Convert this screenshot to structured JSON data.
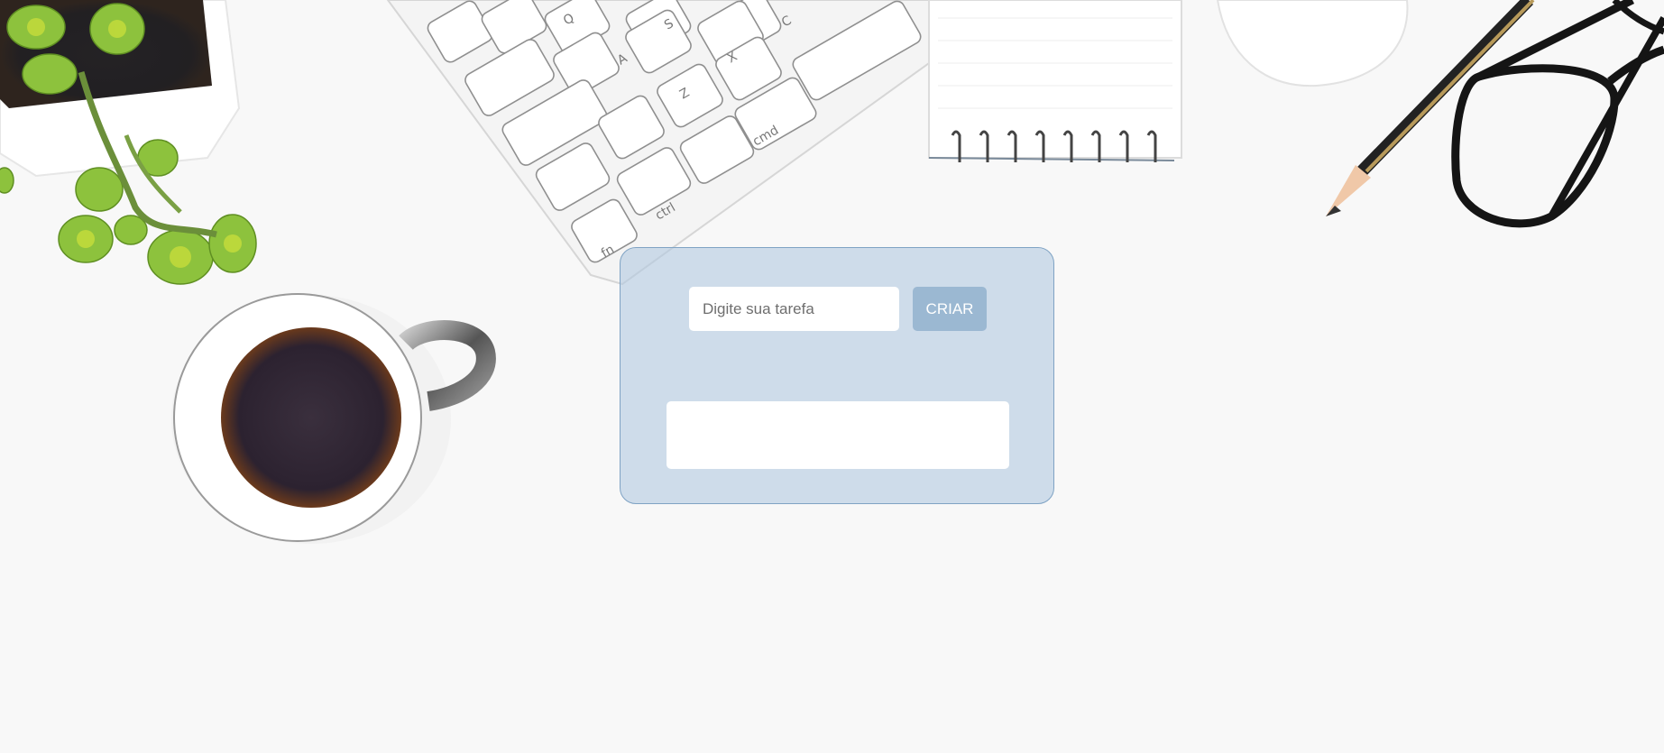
{
  "form": {
    "input_placeholder": "Digite sua tarefa",
    "input_value": "",
    "create_label": "CRIAR"
  },
  "task_list": {
    "items": []
  },
  "colors": {
    "panel": "#b0c8e0",
    "panel_border": "#7fa3c4",
    "button": "#9bb8d2",
    "button_text": "#ffffff"
  },
  "background": {
    "scene": "desk",
    "objects": [
      "potted-plant",
      "keyboard",
      "notepad",
      "mouse",
      "pencil",
      "glasses",
      "coffee-cup"
    ]
  }
}
